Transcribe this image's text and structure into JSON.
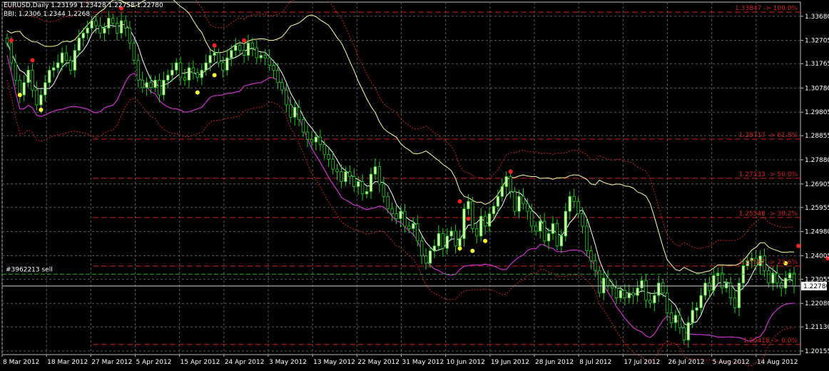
{
  "header": {
    "symbol_line": "EURUSD,Daily  1.23199 1.23428 1.22758 1.22780",
    "indicator_line": "BBI: 1.2306  1.2344  1.2268"
  },
  "colors": {
    "background": "#000000",
    "grid": "#5a5a5a",
    "bull_candle": "#d8ffb0",
    "bear_candle": "#000000",
    "wick": "#22cc22",
    "upper_band": "#ffff99",
    "middle_line": "#ffffff",
    "lower_band": "#cc33cc",
    "fib_lines": "#cc2222",
    "order_line": "#22aa22",
    "fractal_high": "#ff2222",
    "fractal_low": "#ffff33"
  },
  "chart_data": {
    "type": "candlestick",
    "symbol": "EURUSD",
    "timeframe": "Daily",
    "ylim": [
      1.2001,
      1.3425
    ],
    "y_ticks": [
      "1.33680",
      "1.32705",
      "1.31765",
      "1.30780",
      "1.29805",
      "1.28855",
      "1.27880",
      "1.26905",
      "1.25955",
      "1.24980",
      "1.24005",
      "1.23055",
      "1.22080",
      "1.21130",
      "1.20155"
    ],
    "x_tick_labels": [
      "8 Mar 2012",
      "18 Mar 2012",
      "27 Mar 2012",
      "5 Apr 2012",
      "15 Apr 2012",
      "24 Apr 2012",
      "3 May 2012",
      "13 May 2012",
      "22 May 2012",
      "31 May 2012",
      "10 Jun 2012",
      "19 Jun 2012",
      "28 Jun 2012",
      "8 Jul 2012",
      "17 Jul 2012",
      "26 Jul 2012",
      "5 Aug 2012",
      "14 Aug 2012"
    ],
    "current_price": "1.22780",
    "order_label": "#3962213 sell",
    "order_price": 1.2326,
    "fib_levels": [
      {
        "price": 1.33847,
        "label": "1.33847 -> 100.0%"
      },
      {
        "price": 1.28717,
        "label": "1.28717 -> 61.8%"
      },
      {
        "price": 1.27133,
        "label": "1.27133 -> 50.0%"
      },
      {
        "price": 1.25548,
        "label": "1.25548 -> 38.2%"
      },
      {
        "price": 1.23587,
        "label": "1.23587 -> 23.6%"
      },
      {
        "price": 1.20418,
        "label": "1.20418 -> 0.0%"
      }
    ],
    "close": [
      1.326,
      1.318,
      1.311,
      1.305,
      1.31,
      1.315,
      1.307,
      1.301,
      1.305,
      1.31,
      1.315,
      1.316,
      1.318,
      1.322,
      1.319,
      1.315,
      1.323,
      1.328,
      1.33,
      1.332,
      1.335,
      1.333,
      1.33,
      1.332,
      1.336,
      1.334,
      1.33,
      1.335,
      1.332,
      1.326,
      1.319,
      1.311,
      1.308,
      1.31,
      1.308,
      1.311,
      1.305,
      1.311,
      1.313,
      1.315,
      1.318,
      1.312,
      1.311,
      1.316,
      1.314,
      1.312,
      1.315,
      1.318,
      1.321,
      1.322,
      1.318,
      1.315,
      1.32,
      1.323,
      1.325,
      1.323,
      1.321,
      1.326,
      1.324,
      1.32,
      1.321,
      1.32,
      1.317,
      1.315,
      1.31,
      1.307,
      1.301,
      1.296,
      1.3,
      1.295,
      1.29,
      1.287,
      1.286,
      1.288,
      1.285,
      1.281,
      1.279,
      1.275,
      1.274,
      1.27,
      1.274,
      1.272,
      1.268,
      1.27,
      1.265,
      1.266,
      1.273,
      1.276,
      1.269,
      1.264,
      1.259,
      1.257,
      1.255,
      1.258,
      1.252,
      1.251,
      1.253,
      1.246,
      1.24,
      1.237,
      1.242,
      1.244,
      1.249,
      1.243,
      1.248,
      1.25,
      1.244,
      1.247,
      1.259,
      1.262,
      1.251,
      1.248,
      1.256,
      1.252,
      1.257,
      1.26,
      1.264,
      1.268,
      1.272,
      1.266,
      1.258,
      1.264,
      1.261,
      1.258,
      1.252,
      1.25,
      1.254,
      1.246,
      1.249,
      1.253,
      1.244,
      1.248,
      1.258,
      1.264,
      1.262,
      1.257,
      1.252,
      1.242,
      1.238,
      1.234,
      1.225,
      1.231,
      1.228,
      1.227,
      1.223,
      1.226,
      1.223,
      1.225,
      1.224,
      1.227,
      1.23,
      1.222,
      1.221,
      1.224,
      1.229,
      1.225,
      1.217,
      1.213,
      1.216,
      1.211,
      1.206,
      1.213,
      1.218,
      1.219,
      1.224,
      1.229,
      1.226,
      1.232,
      1.233,
      1.227,
      1.229,
      1.223,
      1.219,
      1.229,
      1.236,
      1.238,
      1.239,
      1.236,
      1.24,
      1.234,
      1.229,
      1.233,
      1.229,
      1.227,
      1.231,
      1.233,
      1.2278
    ],
    "fractal_highs": [
      [
        1,
        1.327
      ],
      [
        6,
        1.319
      ],
      [
        27,
        1.34
      ],
      [
        49,
        1.325
      ],
      [
        56,
        1.327
      ],
      [
        107,
        1.262
      ],
      [
        109,
        1.255
      ],
      [
        119,
        1.274
      ],
      [
        187,
        1.244
      ],
      [
        194,
        1.239
      ]
    ],
    "fractal_lows": [
      [
        3,
        1.305
      ],
      [
        8,
        1.299
      ],
      [
        45,
        1.306
      ],
      [
        49,
        1.313
      ],
      [
        107,
        1.243
      ],
      [
        110,
        1.242
      ],
      [
        113,
        1.246
      ],
      [
        184,
        1.237
      ],
      [
        193,
        1.227
      ]
    ]
  }
}
